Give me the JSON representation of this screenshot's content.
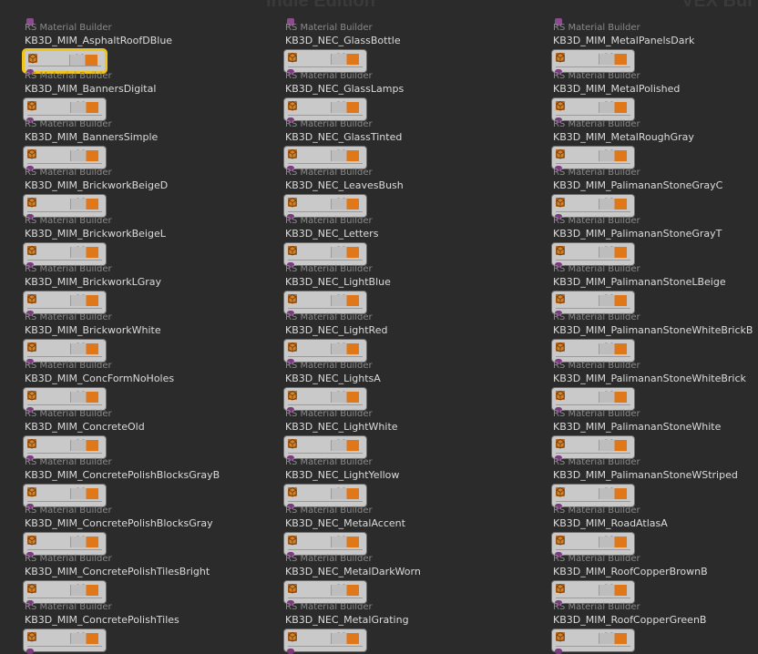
{
  "watermarks": {
    "left": "Indie Edition",
    "right": "VEX Bui"
  },
  "colors": {
    "background": "#2b2b2b",
    "node_body": "#c9c9c9",
    "selection": "#f0c419",
    "flag_orange": "#e0781a",
    "output_connector": "#7a3a7e"
  },
  "node_type_label": "RS Material Builder",
  "columns": [
    {
      "nodes": [
        "KB3D_MIM_AsphaltRoofDBlue",
        "KB3D_MIM_BannersDigital",
        "KB3D_MIM_BannersSimple",
        "KB3D_MIM_BrickworkBeigeD",
        "KB3D_MIM_BrickworkBeigeL",
        "KB3D_MIM_BrickworkLGray",
        "KB3D_MIM_BrickworkWhite",
        "KB3D_MIM_ConcFormNoHoles",
        "KB3D_MIM_ConcreteOld",
        "KB3D_MIM_ConcretePolishBlocksGrayB",
        "KB3D_MIM_ConcretePolishBlocksGray",
        "KB3D_MIM_ConcretePolishTilesBright",
        "KB3D_MIM_ConcretePolishTiles"
      ]
    },
    {
      "nodes": [
        "KB3D_NEC_GlassBottle",
        "KB3D_NEC_GlassLamps",
        "KB3D_NEC_GlassTinted",
        "KB3D_NEC_LeavesBush",
        "KB3D_NEC_Letters",
        "KB3D_NEC_LightBlue",
        "KB3D_NEC_LightRed",
        "KB3D_NEC_LightsA",
        "KB3D_NEC_LightWhite",
        "KB3D_NEC_LightYellow",
        "KB3D_NEC_MetalAccent",
        "KB3D_NEC_MetalDarkWorn",
        "KB3D_NEC_MetalGrating"
      ]
    },
    {
      "nodes": [
        "KB3D_MIM_MetalPanelsDark",
        "KB3D_MIM_MetalPolished",
        "KB3D_MIM_MetalRoughGray",
        "KB3D_MIM_PalimananStoneGrayC",
        "KB3D_MIM_PalimananStoneGrayT",
        "KB3D_MIM_PalimananStoneLBeige",
        "KB3D_MIM_PalimananStoneWhiteBrickB",
        "KB3D_MIM_PalimananStoneWhiteBrick",
        "KB3D_MIM_PalimananStoneWhite",
        "KB3D_MIM_PalimananStoneWStriped",
        "KB3D_MIM_RoadAtlasA",
        "KB3D_MIM_RoofCopperBrownB",
        "KB3D_MIM_RoofCopperGreenB"
      ]
    }
  ],
  "selected": {
    "column": 0,
    "index": 0
  }
}
